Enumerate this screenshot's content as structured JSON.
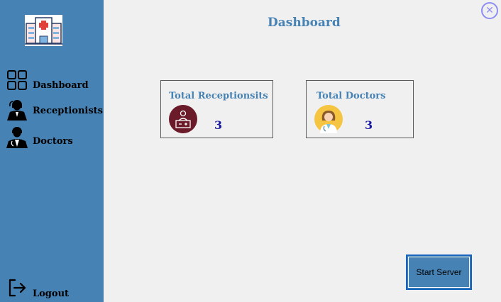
{
  "header": {
    "title": "Dashboard"
  },
  "sidebar": {
    "logo_icon": "hospital-icon",
    "items": [
      {
        "label": "Dashboard",
        "icon": "grid-icon"
      },
      {
        "label": "Receptionists",
        "icon": "receptionist-icon"
      },
      {
        "label": "Doctors",
        "icon": "doctor-icon"
      }
    ],
    "logout": {
      "label": "Logout",
      "icon": "logout-icon"
    }
  },
  "cards": [
    {
      "title": "Total Receptionsits",
      "count": "3",
      "icon": "reception-desk-icon"
    },
    {
      "title": "Total Doctors",
      "count": "3",
      "icon": "female-doctor-icon"
    }
  ],
  "actions": {
    "start_server_label": "Start Server",
    "close_icon": "close-icon"
  },
  "colors": {
    "sidebar": "#4682b4",
    "accent_title": "#4682b4",
    "count": "#1a1aa0",
    "receptionist_icon_bg": "#6b1a2a",
    "doctor_icon_bg": "#f5c542",
    "close": "#8e8ef0"
  }
}
